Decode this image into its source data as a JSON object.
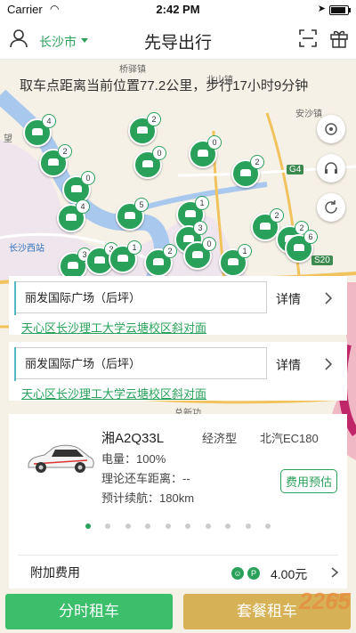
{
  "status_bar": {
    "carrier": "Carrier",
    "time": "2:42 PM"
  },
  "nav": {
    "city": "长沙市",
    "title": "先导出行"
  },
  "map": {
    "distance_text": "取车点距离当前位置77.2公里，步行17小时9分钟",
    "labels": {
      "qiaoyi": "桥驿镇",
      "beishan": "北山镇",
      "anshabei": "安沙镇",
      "wang": "望",
      "changsha_west": "长沙西站",
      "g4": "G4",
      "s20": "S20",
      "bottom_partial": "总新功"
    },
    "marker_counts": [
      "4",
      "2",
      "2",
      "0",
      "0",
      "4",
      "2",
      "5",
      "0",
      "1",
      "2",
      "3",
      "2",
      "6",
      "3",
      "3",
      "1",
      "2",
      "0",
      "1"
    ]
  },
  "cards": [
    {
      "name": "丽发国际广场（后坪）",
      "detail": "详情",
      "address": "天心区长沙理工大学云塘校区斜对面"
    },
    {
      "name": "丽发国际广场（后坪）",
      "detail": "详情",
      "address": "天心区长沙理工大学云塘校区斜对面"
    }
  ],
  "vehicle": {
    "plate": "湘A2Q33L",
    "class": "经济型",
    "model": "北汽EC180",
    "battery_label": "电量：100%",
    "return_distance_label": "理论还车距离：--",
    "range_label": "预计续航：180km",
    "estimate_button": "费用预估",
    "page_dots": 10,
    "active_dot": 0
  },
  "extra_fee": {
    "label": "附加费用",
    "price": "4.00元",
    "p_icon": "P"
  },
  "buttons": {
    "time_rental": "分时租车",
    "package_rental": "套餐租车"
  },
  "watermark": {
    "main": "2265",
    "sub": "手游网"
  },
  "colors": {
    "accent_green": "#2aa15a",
    "package_gold": "#d6b156",
    "card_accent": "#53b7c6"
  }
}
